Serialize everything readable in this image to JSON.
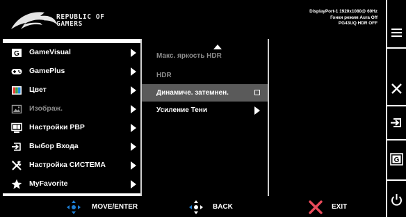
{
  "header": {
    "brand_line1": "REPUBLIC OF",
    "brand_line2": "GAMERS",
    "info_line1": "DisplayPort-1 1920x1080@ 60Hz",
    "info_line2": "Гонки режим Aura Off",
    "info_line3": "PG43UQ HDR OFF"
  },
  "main_menu": {
    "items": [
      {
        "label": "GameVisual",
        "icon": "g-badge-icon",
        "dimmed": false
      },
      {
        "label": "GamePlus",
        "icon": "gamepad-icon",
        "dimmed": false
      },
      {
        "label": "Цвет",
        "icon": "color-icon",
        "dimmed": false
      },
      {
        "label": "Изображ.",
        "icon": "image-icon",
        "dimmed": true
      },
      {
        "label": "Настройки PBP",
        "icon": "pbp-icon",
        "dimmed": false
      },
      {
        "label": "Выбор Входа",
        "icon": "input-icon",
        "dimmed": false
      },
      {
        "label": "Настройка СИСТЕМА",
        "icon": "wrench-screwdriver-icon",
        "dimmed": false
      },
      {
        "label": "MyFavorite",
        "icon": "star-icon",
        "dimmed": false
      }
    ]
  },
  "submenu": {
    "items": [
      {
        "label": "Макс. яркость HDR",
        "dimmed": true,
        "selected": false,
        "control": "none"
      },
      {
        "label": "HDR",
        "dimmed": true,
        "selected": false,
        "control": "none"
      },
      {
        "label": "Динамиче. затемнен.",
        "dimmed": false,
        "selected": true,
        "control": "checkbox-unchecked"
      },
      {
        "label": "Усиление Тени",
        "dimmed": false,
        "selected": false,
        "control": "arrow"
      }
    ]
  },
  "footer": {
    "move_enter_label": "MOVE/ENTER",
    "back_label": "BACK",
    "exit_label": "EXIT"
  },
  "side_keys": [
    "menu-icon",
    "close-icon",
    "input-select-icon",
    "gamevisual-icon",
    "power-icon"
  ],
  "colors": {
    "background": "#000000",
    "accent_blue": "#1e7fd6",
    "exit_red": "#e84a5a",
    "dim_text": "#8a8a8a",
    "selection": "#5a5a5a"
  }
}
